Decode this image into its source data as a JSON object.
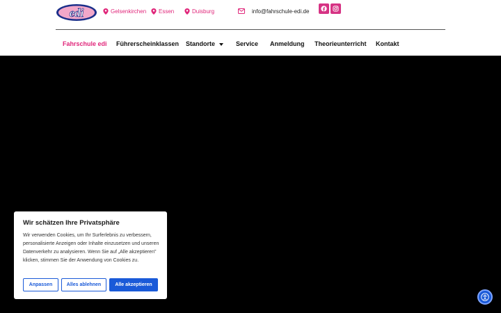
{
  "header": {
    "locations": [
      "Gelsenkirchen",
      "Essen",
      "Duisburg"
    ],
    "email": "info@fahrschule-edi.de",
    "social": [
      "facebook-icon",
      "instagram-icon"
    ]
  },
  "logo": {
    "text": "edi"
  },
  "nav": {
    "items": [
      "Fahrschule edi",
      "Führerscheinklassen",
      "Standorte",
      "Service",
      "Anmeldung",
      "Theorieunterricht",
      "Kontakt"
    ]
  },
  "consent": {
    "title": "Wir schätzen Ihre Privatsphäre",
    "body": "Wir verwenden Cookies, um Ihr Surferlebnis zu verbessern, personalisierte Anzeigen oder Inhalte einzusetzen und unseren Datenverkehr zu analysieren. Wenn Sie auf „Alle akzeptieren\" klicken, stimmen Sie der Anwendung von Cookies zu.",
    "buttons": {
      "customize": "Anpassen",
      "reject": "Alles ablehnen",
      "accept": "Alle akzeptieren"
    }
  },
  "colors": {
    "brand_pink": "#e0267a",
    "accent_blue": "#1a5ad8",
    "hero_bg": "#000000"
  }
}
